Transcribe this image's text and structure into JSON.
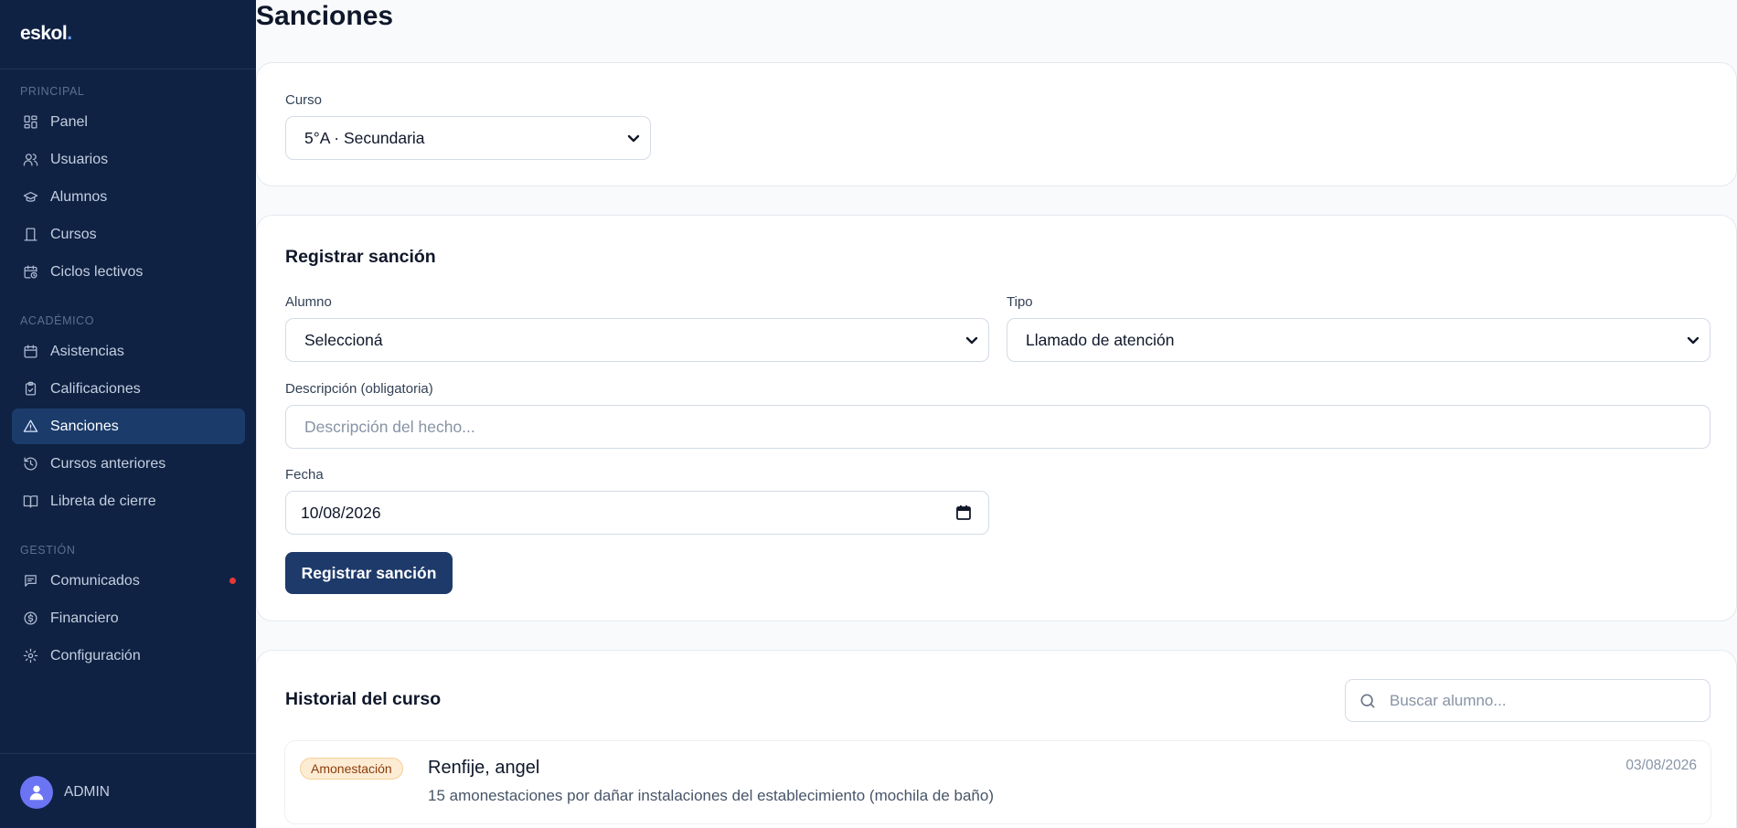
{
  "app": {
    "logo": "eskol",
    "logo_dot": "."
  },
  "sidebar": {
    "sections": [
      {
        "label": "PRINCIPAL"
      },
      {
        "label": "ACADÉMICO"
      },
      {
        "label": "GESTIÓN"
      }
    ],
    "items": [
      {
        "label": "Panel",
        "icon": "grid-icon"
      },
      {
        "label": "Usuarios",
        "icon": "users-icon"
      },
      {
        "label": "Alumnos",
        "icon": "graduation-cap-icon"
      },
      {
        "label": "Cursos",
        "icon": "door-icon"
      },
      {
        "label": "Ciclos lectivos",
        "icon": "calendar-clock-icon"
      },
      {
        "label": "Asistencias",
        "icon": "calendar-icon"
      },
      {
        "label": "Calificaciones",
        "icon": "clipboard-check-icon"
      },
      {
        "label": "Sanciones",
        "icon": "warning-triangle-icon",
        "active": true
      },
      {
        "label": "Cursos anteriores",
        "icon": "history-icon"
      },
      {
        "label": "Libreta de cierre",
        "icon": "book-open-icon"
      },
      {
        "label": "Comunicados",
        "icon": "message-icon",
        "notification": true
      },
      {
        "label": "Financiero",
        "icon": "dollar-circle-icon"
      },
      {
        "label": "Configuración",
        "icon": "gear-icon"
      }
    ],
    "user": {
      "name": "ADMIN"
    }
  },
  "page": {
    "title": "Sanciones"
  },
  "course_card": {
    "label": "Curso",
    "selected": "5°A · Secundaria"
  },
  "register_card": {
    "title": "Registrar sanción",
    "student_label": "Alumno",
    "student_selected": "Seleccioná",
    "type_label": "Tipo",
    "type_selected": "Llamado de atención",
    "description_label": "Descripción (obligatoria)",
    "description_placeholder": "Descripción del hecho...",
    "date_label": "Fecha",
    "date_value": "10/08/2026",
    "submit_label": "Registrar sanción"
  },
  "history_card": {
    "title": "Historial del curso",
    "search_placeholder": "Buscar alumno...",
    "records": [
      {
        "badge": "Amonestación",
        "name": "Renfije, angel",
        "description": "15 amonestaciones por dañar instalaciones del establecimiento (mochila de baño)",
        "date": "03/08/2026"
      }
    ]
  },
  "colors": {
    "sidebar_bg": "#0f2244",
    "active_item_bg": "#1b3c6b",
    "primary_button": "#1e3a6a",
    "badge_bg": "#fdecd4",
    "badge_text": "#8a3c0c",
    "notification_dot": "#e53935",
    "avatar_bg": "#6b74f2"
  }
}
